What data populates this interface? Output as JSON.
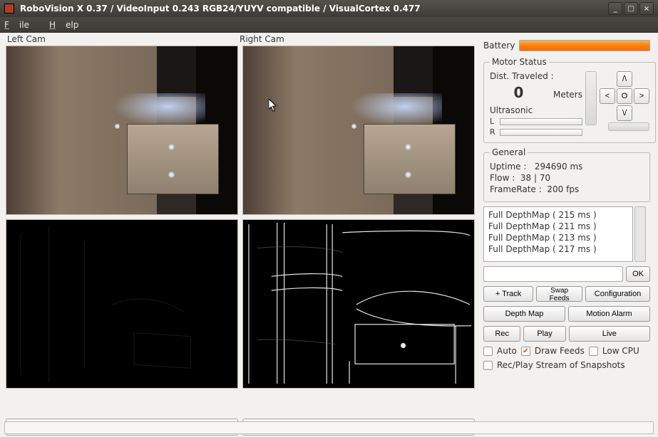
{
  "window": {
    "title": "RoboVision X 0.37 / VideoInput 0.243 RGB24/YUYV compatible / VisualCortex 0.477"
  },
  "menu": {
    "file": "File",
    "help": "Help"
  },
  "cams": {
    "left_label": "Left Cam",
    "right_label": "Right Cam"
  },
  "battery": {
    "label": "Battery"
  },
  "motor_status": {
    "legend": "Motor Status",
    "dist_label": "Dist. Traveled :",
    "dist_value": "0",
    "dist_unit": "Meters",
    "ultrasonic_label": "Ultrasonic",
    "us_left": "L",
    "us_right": "R",
    "dpad": {
      "up": "/\\",
      "left": "<",
      "center": "O",
      "right": ">",
      "down": "\\/"
    }
  },
  "general": {
    "legend": "General",
    "uptime_label": "Uptime :",
    "uptime_value": "294690 ms",
    "flow_label": "Flow :",
    "flow_value": "38 | 70",
    "framerate_label": "FrameRate :",
    "framerate_value": "200 fps"
  },
  "log": {
    "lines": [
      "Full DepthMap ( 215 ms )",
      "Full DepthMap ( 211 ms )",
      "Full DepthMap ( 213 ms )",
      "Full DepthMap ( 217 ms )"
    ]
  },
  "cmd": {
    "ok": "OK"
  },
  "buttons": {
    "track": "+ Track",
    "swap": "Swap Feeds",
    "config": "Configuration",
    "depth": "Depth Map",
    "motion": "Motion Alarm",
    "rec": "Rec",
    "play": "Play",
    "live": "Live"
  },
  "checks": {
    "auto": "Auto",
    "draw_feeds": "Draw Feeds",
    "low_cpu": "Low CPU",
    "rec_play_snap": "Rec/Play Stream of Snapshots"
  },
  "window_controls": {
    "min": "_",
    "max": "□",
    "close": "×"
  }
}
